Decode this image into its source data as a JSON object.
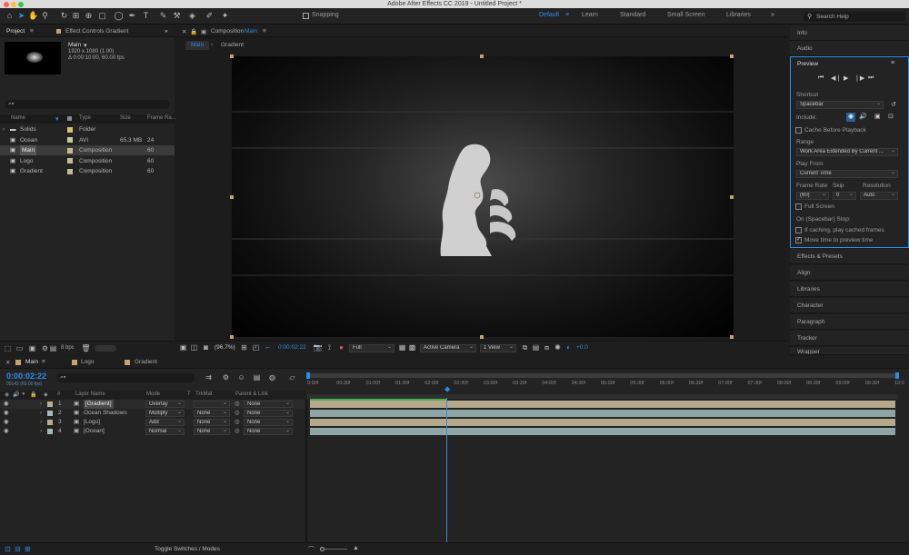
{
  "window": {
    "title": "Adobe After Effects CC 2019 - Untitled Project *"
  },
  "toolbar": {
    "snapping": "Snapping",
    "workspaces": [
      "Default",
      "Learn",
      "Standard",
      "Small Screen",
      "Libraries"
    ],
    "active_workspace": "Default",
    "search_placeholder": "Search Help"
  },
  "project": {
    "tab_project": "Project",
    "tab_effect": "Effect Controls Gradient",
    "thumb_name": "Main",
    "thumb_info1": "1920 x 1080 (1.00)",
    "thumb_info2": "Δ 0:00:10:00, 60.00 fps",
    "search_glyph": "⌕▾",
    "columns": {
      "name": "Name",
      "type": "Type",
      "size": "Size",
      "frame": "Frame Ra..."
    },
    "items": [
      {
        "name": "Solids",
        "type": "Folder",
        "size": "",
        "frame": "",
        "color": "#d4c36b"
      },
      {
        "name": "Ocean",
        "type": "AVI",
        "size": "65.3 MB",
        "frame": "24",
        "color": "#c9c9a0"
      },
      {
        "name": "Main",
        "type": "Composition",
        "size": "",
        "frame": "60",
        "color": "#c7b895"
      },
      {
        "name": "Logo",
        "type": "Composition",
        "size": "",
        "frame": "60",
        "color": "#c7b895"
      },
      {
        "name": "Gradient",
        "type": "Composition",
        "size": "",
        "frame": "60",
        "color": "#c7b895"
      }
    ],
    "bpc": "8 bpc"
  },
  "comp": {
    "tab": "Composition",
    "tab_name": "Main",
    "bc_main": "Main",
    "bc_gradient": "Gradient",
    "zoom": "(96.7%)",
    "timecode": "0:00:02:22",
    "resolution": "Full",
    "camera": "Active Camera",
    "view": "1 View",
    "exposure": "+0.0"
  },
  "right": {
    "info": "Info",
    "audio": "Audio",
    "preview": "Preview",
    "shortcut_label": "Shortcut",
    "shortcut": "Spacebar",
    "include_label": "Include:",
    "cache": "Cache Before Playback",
    "range_label": "Range",
    "range": "Work Area Extended By Current ...",
    "playfrom_label": "Play From",
    "playfrom": "Current Time",
    "framerate_label": "Frame Rate",
    "skip_label": "Skip",
    "resolution_label": "Resolution",
    "framerate": "(60)",
    "skip": "0",
    "resolution": "Auto",
    "fullscreen": "Full Screen",
    "stop_label": "On (Spacebar) Stop:",
    "stop1": "If caching, play cached frames",
    "stop2": "Move time to preview time",
    "panels": [
      "Effects & Presets",
      "Align",
      "Libraries",
      "Character",
      "Paragraph",
      "Tracker",
      "Wrapper"
    ]
  },
  "timeline": {
    "tabs": [
      "Main",
      "Logo",
      "Gradient"
    ],
    "timecode": "0:00:02:22",
    "frames": "00142 (60.00 fps)",
    "search_glyph": "⌕▾",
    "headers": {
      "num": "#",
      "layer": "Layer Name",
      "mode": "Mode",
      "t": "T",
      "trk": "TrkMat",
      "parent": "Parent & Link"
    },
    "layers": [
      {
        "num": "1",
        "name": "[Gradient]",
        "mode": "Overlay",
        "trk": "",
        "parent": "None",
        "color": "#b9ae8f"
      },
      {
        "num": "2",
        "name": "Ocean Shadows",
        "mode": "Multiply",
        "trk": "None",
        "parent": "None",
        "color": "#a3b8b8"
      },
      {
        "num": "3",
        "name": "[Logo]",
        "mode": "Add",
        "trk": "None",
        "parent": "None",
        "color": "#b9ae8f"
      },
      {
        "num": "4",
        "name": "[Ocean]",
        "mode": "Normal",
        "trk": "None",
        "parent": "None",
        "color": "#a3b8b8"
      }
    ],
    "ticks": [
      "0:00f",
      "00:30f",
      "01:00f",
      "01:30f",
      "02:00f",
      "02:30f",
      "03:00f",
      "03:30f",
      "04:00f",
      "04:30f",
      "05:00f",
      "05:30f",
      "06:00f",
      "06:30f",
      "07:00f",
      "07:30f",
      "08:00f",
      "08:30f",
      "09:00f",
      "09:30f",
      "10:0"
    ],
    "toggle": "Toggle Switches / Modes"
  }
}
